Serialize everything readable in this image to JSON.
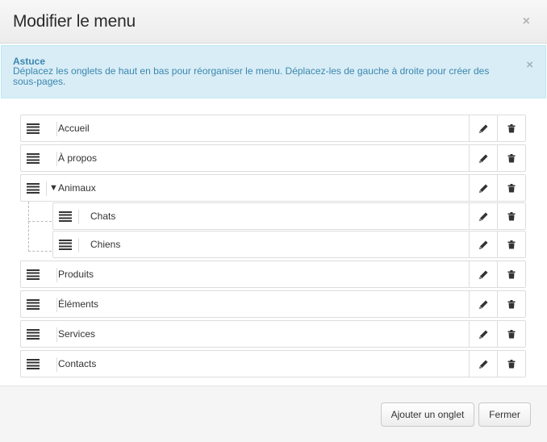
{
  "modal": {
    "title": "Modifier le menu",
    "close_glyph": "×"
  },
  "alert": {
    "title": "Astuce",
    "text": "Déplacez les onglets de haut en bas pour réorganiser le menu. Déplacez-les de gauche à droite pour créer des sous-pages.",
    "close_glyph": "×",
    "colors": {
      "background": "#d9edf7",
      "text": "#3a87ad",
      "border": "#bce8f1"
    }
  },
  "menu": {
    "items": [
      {
        "label": "Accueil"
      },
      {
        "label": "À propos"
      },
      {
        "label": "Animaux",
        "expanded": true,
        "toggle_glyph": "▼"
      },
      {
        "label": "Chats",
        "parent": "Animaux"
      },
      {
        "label": "Chiens",
        "parent": "Animaux"
      },
      {
        "label": "Produits"
      },
      {
        "label": "Éléments"
      },
      {
        "label": "Services"
      },
      {
        "label": "Contacts"
      }
    ],
    "icons": {
      "drag": "drag-handle-icon",
      "edit": "pencil-icon",
      "delete": "trash-icon"
    }
  },
  "footer": {
    "add_label": "Ajouter un onglet",
    "close_label": "Fermer"
  }
}
